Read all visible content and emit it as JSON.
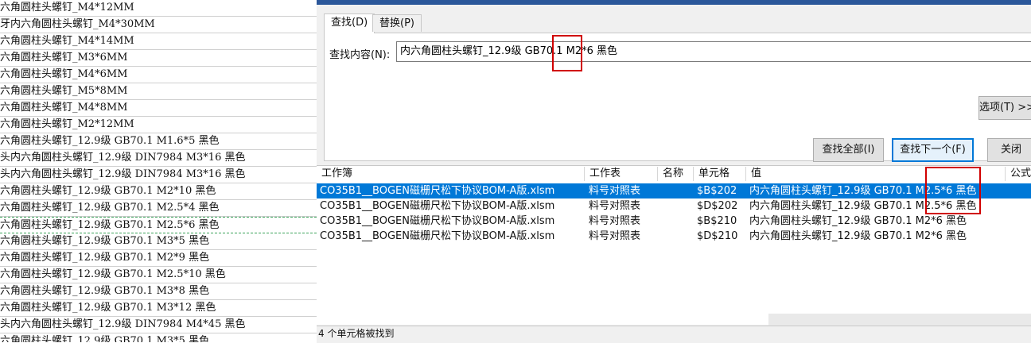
{
  "sheet": {
    "rows": [
      "六角圆柱头螺钉_M4*12MM",
      "牙内六角圆柱头螺钉_M4*30MM",
      "六角圆柱头螺钉_M4*14MM",
      "六角圆柱头螺钉_M3*6MM",
      "六角圆柱头螺钉_M4*6MM",
      "六角圆柱头螺钉_M5*8MM",
      "六角圆柱头螺钉_M4*8MM",
      "六角圆柱头螺钉_M2*12MM",
      "六角圆柱头螺钉_12.9级 GB70.1 M1.6*5 黑色",
      "头内六角圆柱头螺钉_12.9级 DIN7984 M3*16 黑色",
      "头内六角圆柱头螺钉_12.9级 DIN7984 M3*16 黑色",
      "六角圆柱头螺钉_12.9级 GB70.1 M2*10 黑色",
      "六角圆柱头螺钉_12.9级 GB70.1 M2.5*4 黑色",
      "六角圆柱头螺钉_12.9级 GB70.1 M2.5*6 黑色",
      "六角圆柱头螺钉_12.9级 GB70.1 M3*5 黑色",
      "六角圆柱头螺钉_12.9级 GB70.1 M2*9 黑色",
      "六角圆柱头螺钉_12.9级 GB70.1 M2.5*10 黑色",
      "六角圆柱头螺钉_12.9级 GB70.1 M3*8 黑色",
      "六角圆柱头螺钉_12.9级 GB70.1 M3*12 黑色",
      "头内六角圆柱头螺钉_12.9级 DIN7984 M4*45 黑色",
      "六角圆柱头螺钉_12.9级 GB70.1 M3*5 黑色"
    ]
  },
  "dialog": {
    "tabs": {
      "find": "查找(D)",
      "replace": "替换(P)"
    },
    "find_label": "查找内容(N):",
    "find_value": "内六角圆柱头螺钉_12.9级 GB70.1 M2*6 黑色",
    "buttons": {
      "options": "选项(T) >>",
      "find_all": "查找全部(I)",
      "find_next": "查找下一个(F)",
      "close": "关闭"
    },
    "columns": {
      "workbook": "工作簿",
      "worksheet": "工作表",
      "name": "名称",
      "cell": "单元格",
      "value": "值",
      "formula": "公式"
    },
    "results": [
      {
        "workbook": "CO35B1__BOGEN磁栅尺松下协议BOM-A版.xlsm",
        "worksheet": "料号对照表",
        "name": "",
        "cell": "$B$202",
        "value": "内六角圆柱头螺钉_12.9级 GB70.1 M2.5*6 黑色"
      },
      {
        "workbook": "CO35B1__BOGEN磁栅尺松下协议BOM-A版.xlsm",
        "worksheet": "料号对照表",
        "name": "",
        "cell": "$D$202",
        "value": "内六角圆柱头螺钉_12.9级 GB70.1 M2.5*6 黑色"
      },
      {
        "workbook": "CO35B1__BOGEN磁栅尺松下协议BOM-A版.xlsm",
        "worksheet": "料号对照表",
        "name": "",
        "cell": "$B$210",
        "value": "内六角圆柱头螺钉_12.9级 GB70.1 M2*6 黑色"
      },
      {
        "workbook": "CO35B1__BOGEN磁栅尺松下协议BOM-A版.xlsm",
        "worksheet": "料号对照表",
        "name": "",
        "cell": "$D$210",
        "value": "内六角圆柱头螺钉_12.9级 GB70.1 M2*6 黑色"
      }
    ],
    "status": "4 个单元格被找到"
  },
  "colors": {
    "selection": "#0078d7",
    "highlight": "#d00000",
    "dialog_bg": "#f0f0f0"
  }
}
